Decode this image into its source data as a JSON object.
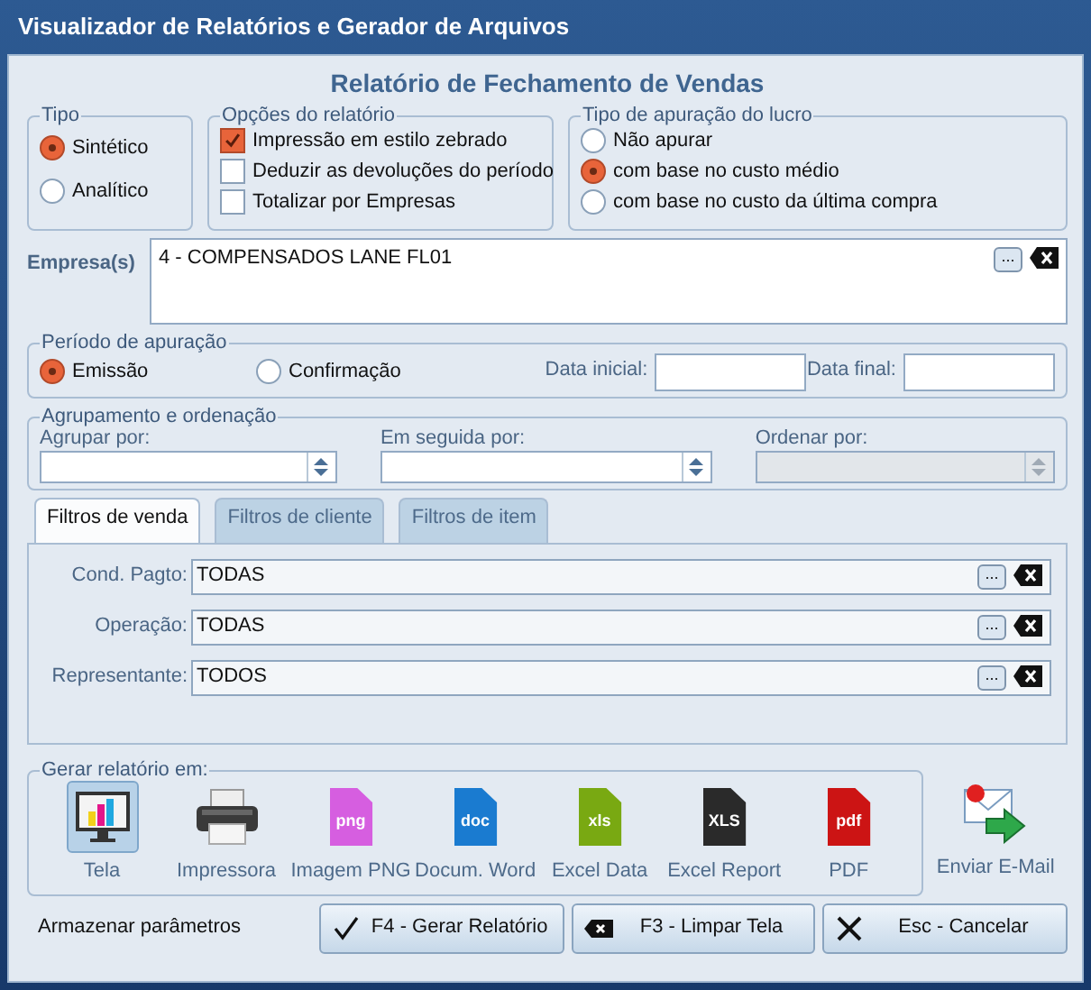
{
  "window": {
    "title": "Visualizador de Relatórios e Gerador de Arquivos"
  },
  "report_title": "Relatório de Fechamento de Vendas",
  "tipo": {
    "label": "Tipo",
    "options": [
      {
        "label": "Sintético",
        "selected": true
      },
      {
        "label": "Analítico",
        "selected": false
      }
    ]
  },
  "opcoes": {
    "label": "Opções do relatório",
    "options": [
      {
        "label": "Impressão em estilo zebrado",
        "checked": true
      },
      {
        "label": "Deduzir as devoluções do período",
        "checked": false
      },
      {
        "label": "Totalizar por Empresas",
        "checked": false
      }
    ]
  },
  "lucro": {
    "label": "Tipo de apuração do lucro",
    "options": [
      {
        "label": "Não apurar",
        "selected": false
      },
      {
        "label": "com base no custo médio",
        "selected": true
      },
      {
        "label": "com base no custo da última compra",
        "selected": false
      }
    ]
  },
  "empresas": {
    "label": "Empresa(s)",
    "value": "4 - COMPENSADOS LANE FL01"
  },
  "periodo": {
    "label": "Período de apuração",
    "options": [
      {
        "label": "Emissão",
        "selected": true
      },
      {
        "label": "Confirmação",
        "selected": false
      }
    ],
    "dates": [
      {
        "label": "Data inicial:"
      },
      {
        "label": "Data final:"
      }
    ]
  },
  "agrupamento": {
    "label": "Agrupamento e ordenação",
    "fields": [
      {
        "label": "Agrupar por:",
        "disabled": false
      },
      {
        "label": "Em seguida por:",
        "disabled": false
      },
      {
        "label": "Ordenar por:",
        "disabled": true
      }
    ]
  },
  "tabs": [
    {
      "label": "Filtros de venda",
      "selected": true
    },
    {
      "label": "Filtros de cliente",
      "selected": false
    },
    {
      "label": "Filtros de item",
      "selected": false
    }
  ],
  "filters": [
    {
      "label": "Cond. Pagto:",
      "value": "TODAS"
    },
    {
      "label": "Operação:",
      "value": "TODAS"
    },
    {
      "label": "Representante:",
      "value": "TODOS"
    }
  ],
  "output": {
    "label": "Gerar relatório em:",
    "items": [
      {
        "label": "Tela",
        "kind": "screen",
        "selected": true
      },
      {
        "label": "Impressora",
        "kind": "printer",
        "selected": false
      },
      {
        "label": "Imagem PNG",
        "kind": "file",
        "icon_text": "png",
        "color": "#d65ee0",
        "selected": false
      },
      {
        "label": "Docum. Word",
        "kind": "file",
        "icon_text": "doc",
        "color": "#1a7bd0",
        "selected": false
      },
      {
        "label": "Excel Data",
        "kind": "file",
        "icon_text": "xls",
        "color": "#79a912",
        "selected": false
      },
      {
        "label": "Excel Report",
        "kind": "file",
        "icon_text": "XLS",
        "color": "#2a2a2a",
        "selected": false
      },
      {
        "label": "PDF",
        "kind": "file",
        "icon_text": "pdf",
        "color": "#cc1414",
        "selected": false
      }
    ]
  },
  "email": {
    "label": "Enviar E-Mail"
  },
  "store_label": "Armazenar parâmetros",
  "browse_label": "...",
  "buttons": [
    {
      "label": "F4 - Gerar Relatório",
      "kind": "check"
    },
    {
      "label": "F3 - Limpar Tela",
      "kind": "clear"
    },
    {
      "label": "Esc - Cancelar",
      "kind": "cancel"
    }
  ]
}
